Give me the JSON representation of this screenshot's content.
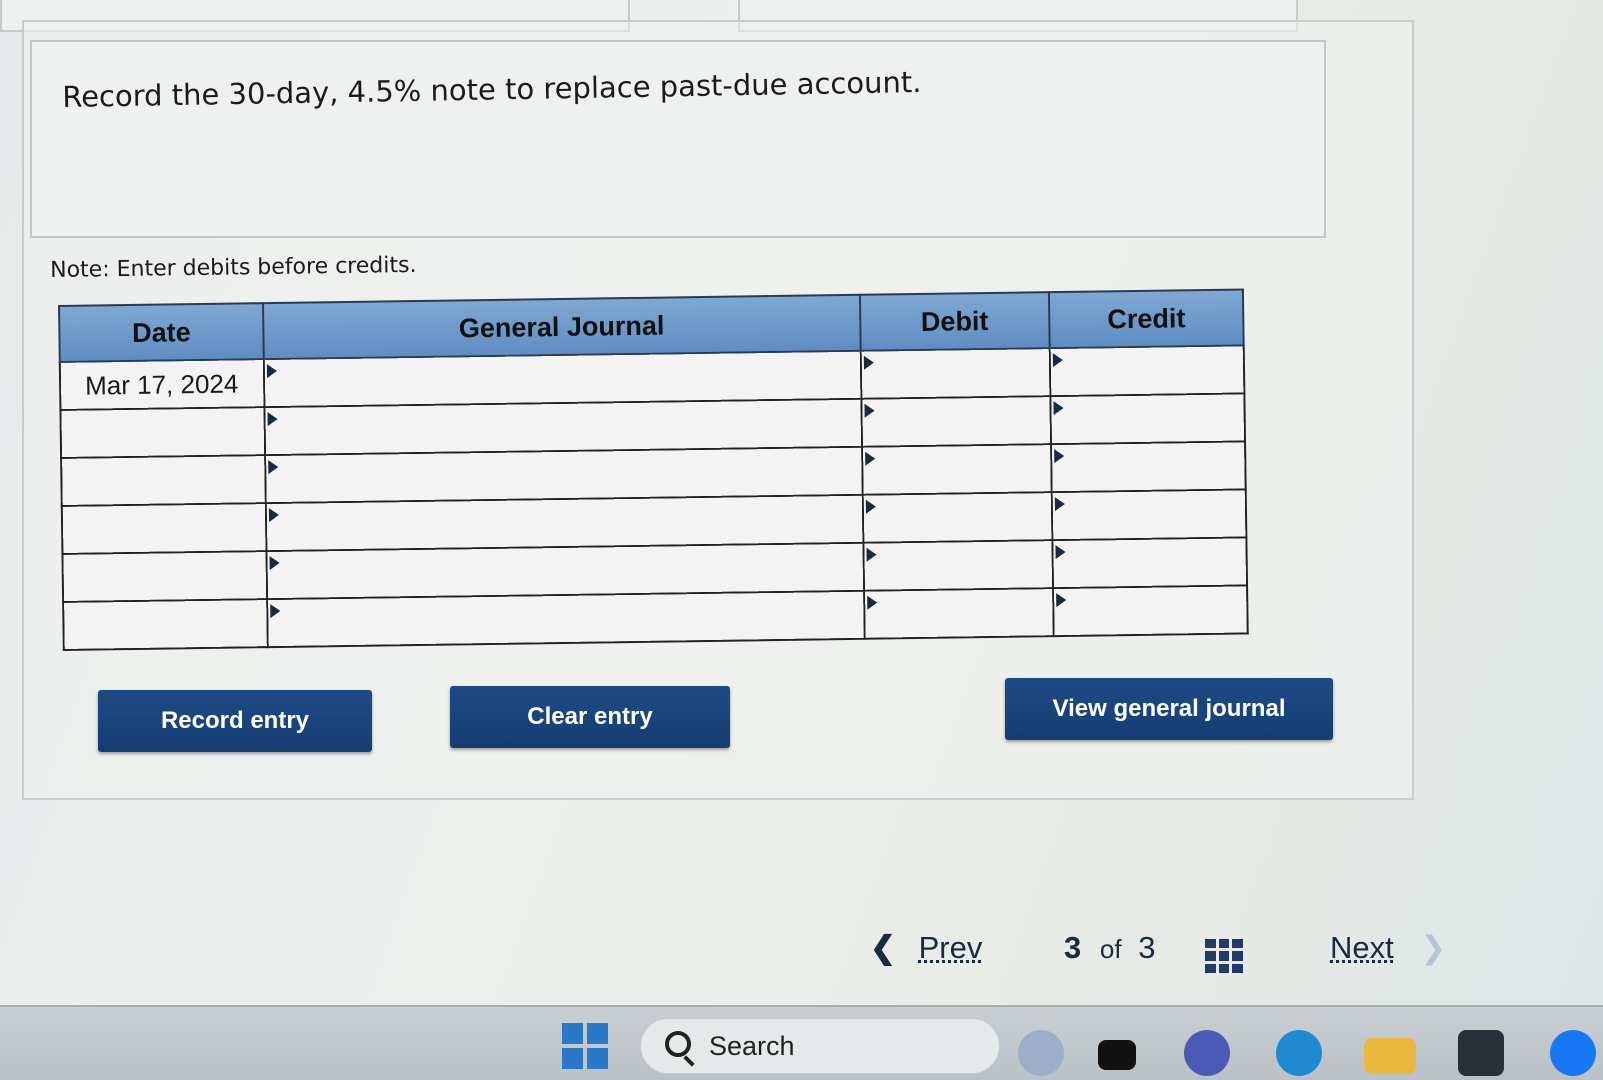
{
  "question": {
    "text": "Record the 30-day, 4.5% note to replace past-due account."
  },
  "note": "Note: Enter debits before credits.",
  "journal": {
    "headers": [
      "Date",
      "General Journal",
      "Debit",
      "Credit"
    ],
    "rows": [
      {
        "date": "Mar 17, 2024",
        "account": "",
        "debit": "",
        "credit": ""
      },
      {
        "date": "",
        "account": "",
        "debit": "",
        "credit": ""
      },
      {
        "date": "",
        "account": "",
        "debit": "",
        "credit": ""
      },
      {
        "date": "",
        "account": "",
        "debit": "",
        "credit": ""
      },
      {
        "date": "",
        "account": "",
        "debit": "",
        "credit": ""
      },
      {
        "date": "",
        "account": "",
        "debit": "",
        "credit": ""
      }
    ]
  },
  "buttons": {
    "record": "Record entry",
    "clear": "Clear entry",
    "view": "View general journal"
  },
  "pager": {
    "prev": "Prev",
    "current": "3",
    "of": "of",
    "total": "3",
    "next": "Next"
  },
  "taskbar": {
    "search_label": "Search",
    "icons": [
      "windows-start-icon",
      "bing-icon",
      "widgets-icon",
      "teams-icon",
      "edge-icon",
      "file-explorer-icon",
      "store-icon",
      "facebook-icon"
    ]
  },
  "colors": {
    "header_blue": "#6f9acb",
    "button_blue": "#1b4479",
    "text_dark": "#1b1b1b"
  }
}
